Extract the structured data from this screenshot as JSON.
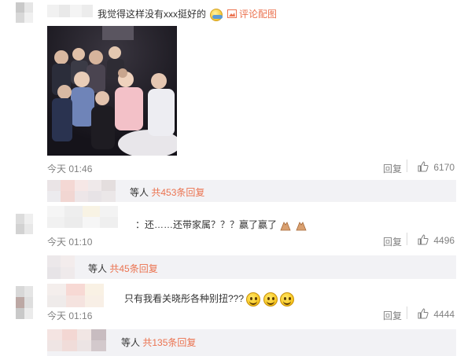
{
  "comments": [
    {
      "text": "我觉得这样没有xxx挺好的",
      "image_link": "评论配图",
      "time": "今天 01:46",
      "reply_label": "回复",
      "likes": "6170",
      "replies_summary": {
        "suffix": "等人",
        "count_link": "共453条回复"
      }
    },
    {
      "text": "：还……还带家属？？？赢了赢了",
      "time": "今天 01:10",
      "reply_label": "回复",
      "likes": "4496",
      "replies_summary": {
        "suffix": "等人",
        "count_link": "共45条回复"
      }
    },
    {
      "text": "只有我看关晓彤各种别扭???",
      "time": "今天 01:16",
      "reply_label": "回复",
      "likes": "4444",
      "replies_summary": {
        "suffix": "等人",
        "count_link": "共135条回复"
      }
    }
  ],
  "colors": {
    "link": "#eb7350",
    "meta": "#808080",
    "strip": "#f2f2f5",
    "text": "#333333"
  },
  "icons": [
    "blush-face-icon",
    "image-icon",
    "thumb-up-icon",
    "pray-hands-icon",
    "smile-face-icon"
  ]
}
